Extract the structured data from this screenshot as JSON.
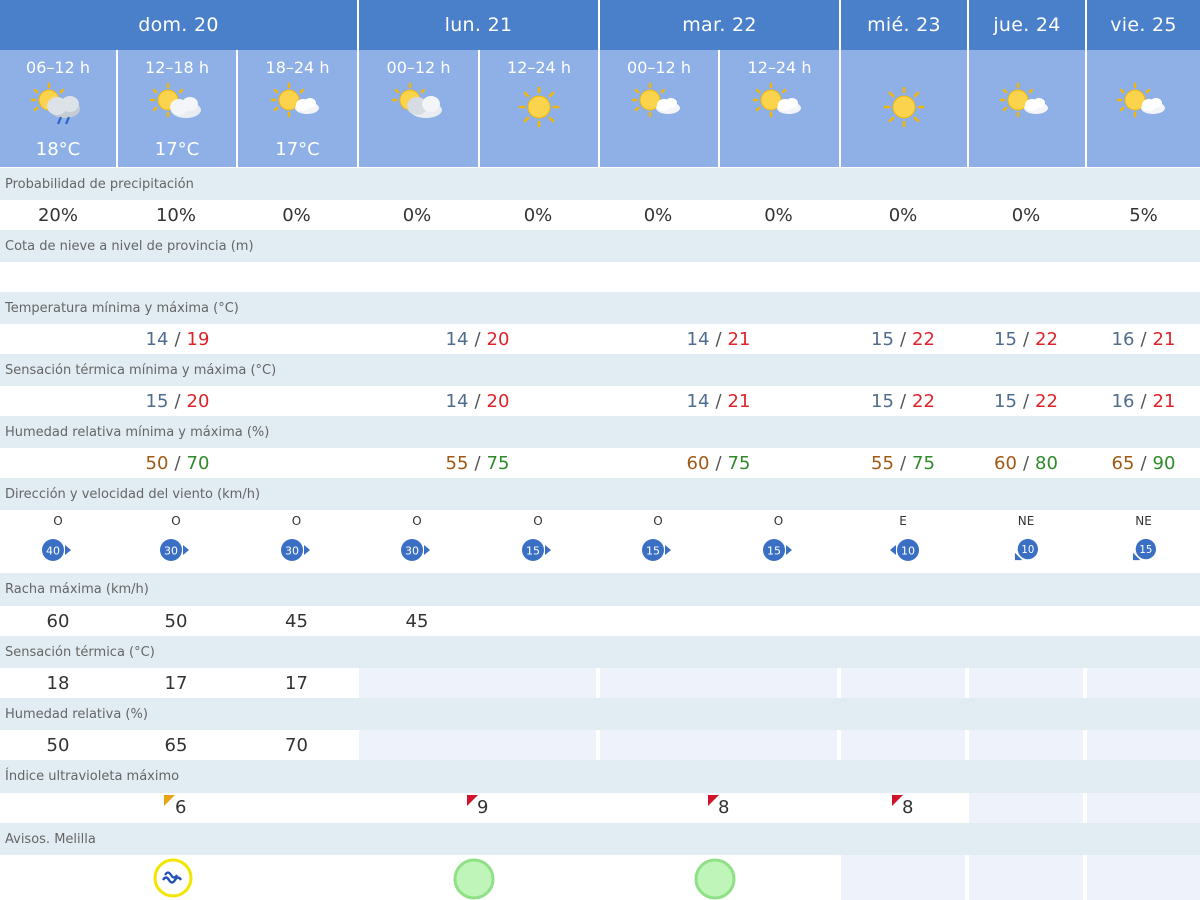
{
  "days": [
    "dom. 20",
    "lun. 21",
    "mar. 22",
    "mié. 23",
    "jue. 24",
    "vie. 25"
  ],
  "periods": [
    {
      "label": "06–12 h",
      "temp": "18°C",
      "icon": "sun-cloud-rain-icon"
    },
    {
      "label": "12–18 h",
      "temp": "17°C",
      "icon": "sun-cloud-icon"
    },
    {
      "label": "18–24 h",
      "temp": "17°C",
      "icon": "sun-cloud-icon"
    },
    {
      "label": "00–12 h",
      "temp": "",
      "icon": "sun-cloud-icon"
    },
    {
      "label": "12–24 h",
      "temp": "",
      "icon": "sun-icon"
    },
    {
      "label": "00–12 h",
      "temp": "",
      "icon": "sun-cloud-icon"
    },
    {
      "label": "12–24 h",
      "temp": "",
      "icon": "sun-cloud-icon"
    },
    {
      "label": "",
      "temp": "",
      "icon": "sun-icon"
    },
    {
      "label": "",
      "temp": "",
      "icon": "sun-cloud-icon"
    },
    {
      "label": "",
      "temp": "",
      "icon": "sun-cloud-icon"
    }
  ],
  "labels": {
    "precip": "Probabilidad de precipitación",
    "snow": "Cota de nieve a nivel de provincia (m)",
    "temp": "Temperatura mínima y máxima (°C)",
    "feel": "Sensación térmica mínima y máxima (°C)",
    "hum": "Humedad relativa mínima y máxima (%)",
    "wind": "Dirección y velocidad del viento (km/h)",
    "gust": "Racha máxima (km/h)",
    "feel_single": "Sensación térmica (°C)",
    "hum_single": "Humedad relativa (%)",
    "uv": "Índice ultravioleta máximo",
    "avisos": "Avisos. Melilla"
  },
  "precip": [
    "20%",
    "10%",
    "0%",
    "0%",
    "0%",
    "0%",
    "0%",
    "0%",
    "0%",
    "5%"
  ],
  "temp": [
    {
      "min": "14",
      "max": "19"
    },
    {
      "min": "14",
      "max": "20"
    },
    {
      "min": "14",
      "max": "21"
    },
    {
      "min": "15",
      "max": "22"
    },
    {
      "min": "15",
      "max": "22"
    },
    {
      "min": "16",
      "max": "21"
    }
  ],
  "feel": [
    {
      "min": "15",
      "max": "20"
    },
    {
      "min": "14",
      "max": "20"
    },
    {
      "min": "14",
      "max": "21"
    },
    {
      "min": "15",
      "max": "22"
    },
    {
      "min": "15",
      "max": "22"
    },
    {
      "min": "16",
      "max": "21"
    }
  ],
  "hum": [
    {
      "min": "50",
      "max": "70"
    },
    {
      "min": "55",
      "max": "75"
    },
    {
      "min": "60",
      "max": "75"
    },
    {
      "min": "55",
      "max": "75"
    },
    {
      "min": "60",
      "max": "80"
    },
    {
      "min": "65",
      "max": "90"
    }
  ],
  "wind": [
    {
      "dir": "O",
      "speed": "40",
      "arrow": "right"
    },
    {
      "dir": "O",
      "speed": "30",
      "arrow": "right"
    },
    {
      "dir": "O",
      "speed": "30",
      "arrow": "right"
    },
    {
      "dir": "O",
      "speed": "30",
      "arrow": "right"
    },
    {
      "dir": "O",
      "speed": "15",
      "arrow": "right"
    },
    {
      "dir": "O",
      "speed": "15",
      "arrow": "right"
    },
    {
      "dir": "O",
      "speed": "15",
      "arrow": "right"
    },
    {
      "dir": "E",
      "speed": "10",
      "arrow": "left"
    },
    {
      "dir": "NE",
      "speed": "10",
      "arrow": "down-left"
    },
    {
      "dir": "NE",
      "speed": "15",
      "arrow": "down-left"
    }
  ],
  "gust": [
    "60",
    "50",
    "45",
    "45",
    "",
    "",
    "",
    "",
    "",
    ""
  ],
  "feel_single": [
    "18",
    "17",
    "17"
  ],
  "hum_single": [
    "50",
    "65",
    "70"
  ],
  "uv": [
    {
      "value": "6",
      "flag_color": "#e8a317"
    },
    {
      "value": "9",
      "flag_color": "#d0152a"
    },
    {
      "value": "8",
      "flag_color": "#d0152a"
    },
    {
      "value": "8",
      "flag_color": "#d0152a"
    }
  ],
  "avisos": [
    {
      "type": "yellow-coastal-icon",
      "color": "#f2e600"
    },
    {
      "type": "green-circle-icon",
      "color": "#9ae893"
    },
    {
      "type": "green-circle-icon",
      "color": "#9ae893"
    }
  ],
  "colors": {
    "header_dark": "#4a7fc9",
    "header_light": "#8fb0e6",
    "label_band": "#e2ecf3",
    "max_red": "#e0232a",
    "min_blue": "#4f6d8e",
    "hum_min": "#a05a16",
    "hum_max": "#2f8a2a",
    "wind_badge": "#3a6fc4"
  }
}
